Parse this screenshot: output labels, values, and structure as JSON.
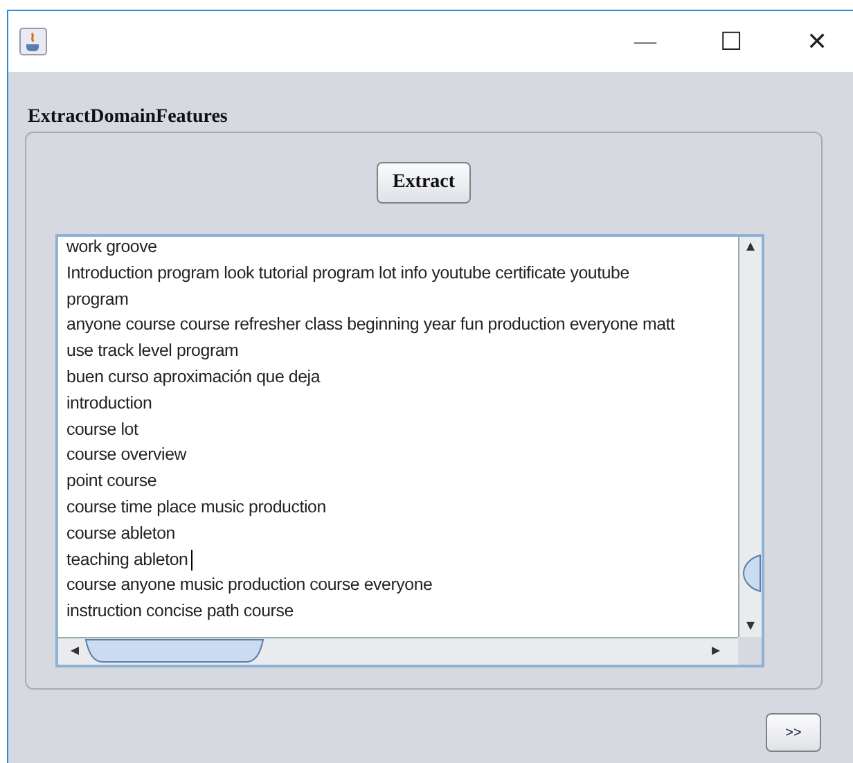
{
  "window": {
    "title_buttons": [
      "—",
      "☐",
      "✕"
    ]
  },
  "panel": {
    "title": "ExtractDomainFeatures"
  },
  "extract_button": {
    "label": "Extract"
  },
  "text_area": {
    "lines": [
      {
        "text": "work groove",
        "caret": false
      },
      {
        "text": "Introduction program look tutorial program lot info youtube certificate youtube",
        "caret": false
      },
      {
        "text": "program",
        "caret": false
      },
      {
        "text": "anyone course course refresher class beginning year fun production everyone matt",
        "caret": false
      },
      {
        "text": "use track level program",
        "caret": false
      },
      {
        "text": "buen curso aproximación que deja",
        "caret": false
      },
      {
        "text": "introduction",
        "caret": false
      },
      {
        "text": "course lot",
        "caret": false
      },
      {
        "text": "course overview",
        "caret": false
      },
      {
        "text": "point course",
        "caret": false
      },
      {
        "text": "course time place music production",
        "caret": false
      },
      {
        "text": "course ableton",
        "caret": false
      },
      {
        "text": "teaching ableton",
        "caret": true
      },
      {
        "text": "course anyone music production course everyone",
        "caret": false
      },
      {
        "text": "instruction concise path course",
        "caret": false
      }
    ]
  },
  "next_button": {
    "label": ">>"
  }
}
